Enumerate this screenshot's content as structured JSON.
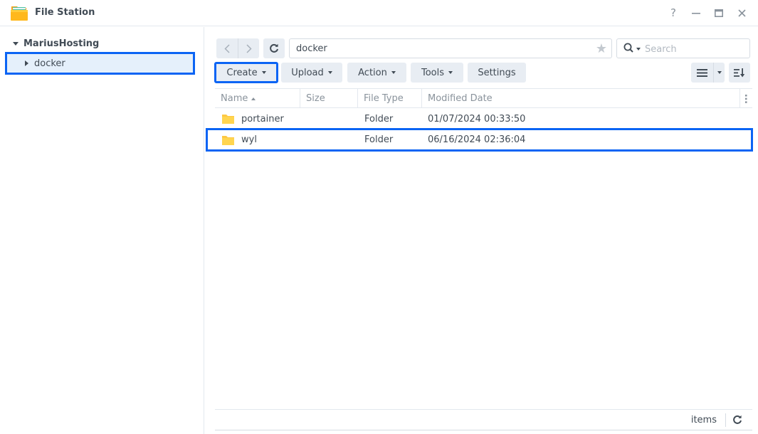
{
  "window": {
    "title": "File Station",
    "controls": {
      "help": "?",
      "minimize": "—",
      "maximize": "▭",
      "close": "✕"
    }
  },
  "sidebar": {
    "root_label": "MariusHosting",
    "items": [
      {
        "label": "docker",
        "selected": true
      }
    ]
  },
  "nav": {
    "back_glyph": "‹",
    "forward_glyph": "›",
    "refresh_glyph": "↻",
    "path": "docker",
    "favorite_glyph": "★",
    "search_placeholder": "Search"
  },
  "toolbar": {
    "create_label": "Create",
    "upload_label": "Upload",
    "action_label": "Action",
    "tools_label": "Tools",
    "settings_label": "Settings"
  },
  "grid": {
    "columns": [
      {
        "label": "Name",
        "sorted": "asc"
      },
      {
        "label": "Size"
      },
      {
        "label": "File Type"
      },
      {
        "label": "Modified Date"
      }
    ],
    "column_menu_glyph": "⋮",
    "rows": [
      {
        "name": "portainer",
        "size": "",
        "type": "Folder",
        "modified": "01/07/2024 00:33:50",
        "highlighted": false
      },
      {
        "name": "wyl",
        "size": "",
        "type": "Folder",
        "modified": "06/16/2024 02:36:04",
        "highlighted": true
      }
    ]
  },
  "footer": {
    "items_label": "items",
    "refresh_glyph": "↻"
  },
  "colors": {
    "accent_highlight": "#0b64f4",
    "selected_bg": "#e5f0fb",
    "folder_yellow": "#fdc843",
    "button_bg": "#e8edf3",
    "text": "#414b55",
    "muted_text": "#8a939c"
  }
}
